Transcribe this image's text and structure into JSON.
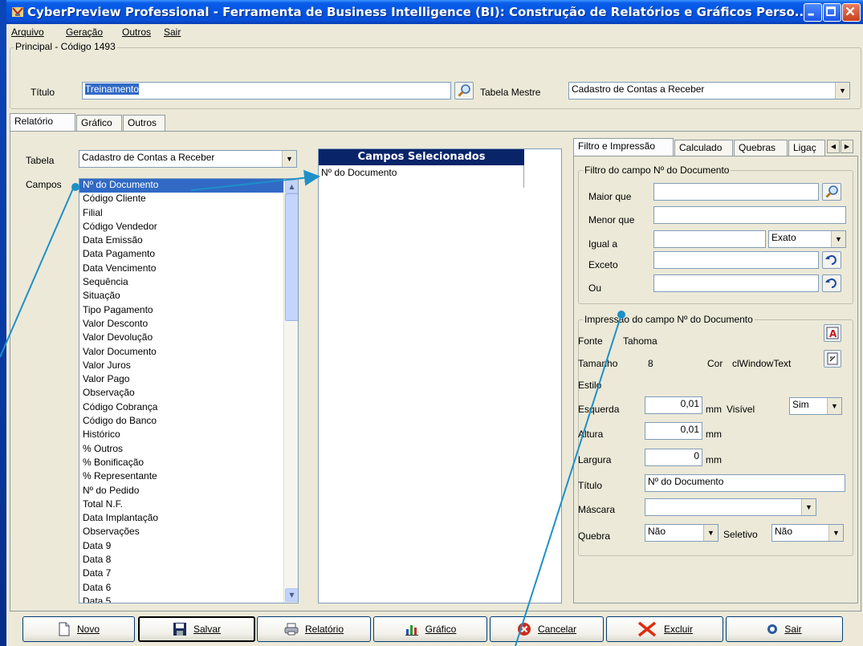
{
  "window": {
    "title": "CyberPreview Professional - Ferramenta de Business Intelligence (BI): Construção de Relatórios e Gráficos Perso..."
  },
  "menu": [
    "Arquivo",
    "Geração",
    "Outros",
    "Sair"
  ],
  "principal": {
    "group_label": "Principal - Código 1493",
    "titulo_label": "Título",
    "titulo_value": "Treinamento",
    "tabela_mestre_label": "Tabela Mestre",
    "tabela_mestre_value": "Cadastro de Contas a Receber"
  },
  "main_tabs": [
    "Relatório",
    "Gráfico",
    "Outros"
  ],
  "left": {
    "tabela_label": "Tabela",
    "tabela_value": "Cadastro de Contas a Receber",
    "campos_label": "Campos",
    "campos": [
      "Nº do Documento",
      "Código Cliente",
      "Filial",
      "Código Vendedor",
      "Data Emissão",
      "Data Pagamento",
      "Data Vencimento",
      "Sequência",
      "Situação",
      "Tipo Pagamento",
      "Valor Desconto",
      "Valor Devolução",
      "Valor Documento",
      "Valor Juros",
      "Valor Pago",
      "Observação",
      "Código Cobrança",
      "Código do Banco",
      "Histórico",
      "% Outros",
      "% Bonificação",
      "% Representante",
      "Nº do Pedido",
      "Total N.F.",
      "Data Implantação",
      "Observações",
      "Data 9",
      "Data 8",
      "Data 7",
      "Data 6",
      "Data 5"
    ],
    "selected_header": "Campos Selecionados",
    "selected": [
      "Nº do Documento"
    ]
  },
  "right_tabs": [
    "Filtro e Impressão",
    "Calculado",
    "Quebras",
    "Ligaç"
  ],
  "filtro": {
    "group_label": "Filtro do campo Nº do Documento",
    "maior_que": "Maior que",
    "menor_que": "Menor que",
    "igual_a": "Igual a",
    "igual_mode": "Exato",
    "exceto": "Exceto",
    "ou": "Ou"
  },
  "impressao": {
    "group_label": "Impressão do campo Nº do Documento",
    "fonte_label": "Fonte",
    "fonte_value": "Tahoma",
    "tamanho_label": "Tamanho",
    "tamanho_value": "8",
    "cor_label": "Cor",
    "cor_value": "clWindowText",
    "estilo_label": "Estilo",
    "esquerda_label": "Esquerda",
    "esquerda_value": "0,01",
    "altura_label": "Altura",
    "altura_value": "0,01",
    "largura_label": "Largura",
    "largura_value": "0",
    "unit": "mm",
    "visivel_label": "Visível",
    "visivel_value": "Sim",
    "titulo_label": "Título",
    "titulo_value": "Nº do Documento",
    "mascara_label": "Máscara",
    "mascara_value": "",
    "quebra_label": "Quebra",
    "quebra_value": "Não",
    "seletivo_label": "Seletivo",
    "seletivo_value": "Não"
  },
  "buttons": {
    "novo": "Novo",
    "salvar": "Salvar",
    "relatorio": "Relatório",
    "grafico": "Gráfico",
    "cancelar": "Cancelar",
    "excluir": "Excluir",
    "sair": "Sair"
  },
  "colors": {
    "selection": "#316ac5",
    "header_navy": "#0a246a",
    "annotation_arrow": "#1e90c8"
  }
}
